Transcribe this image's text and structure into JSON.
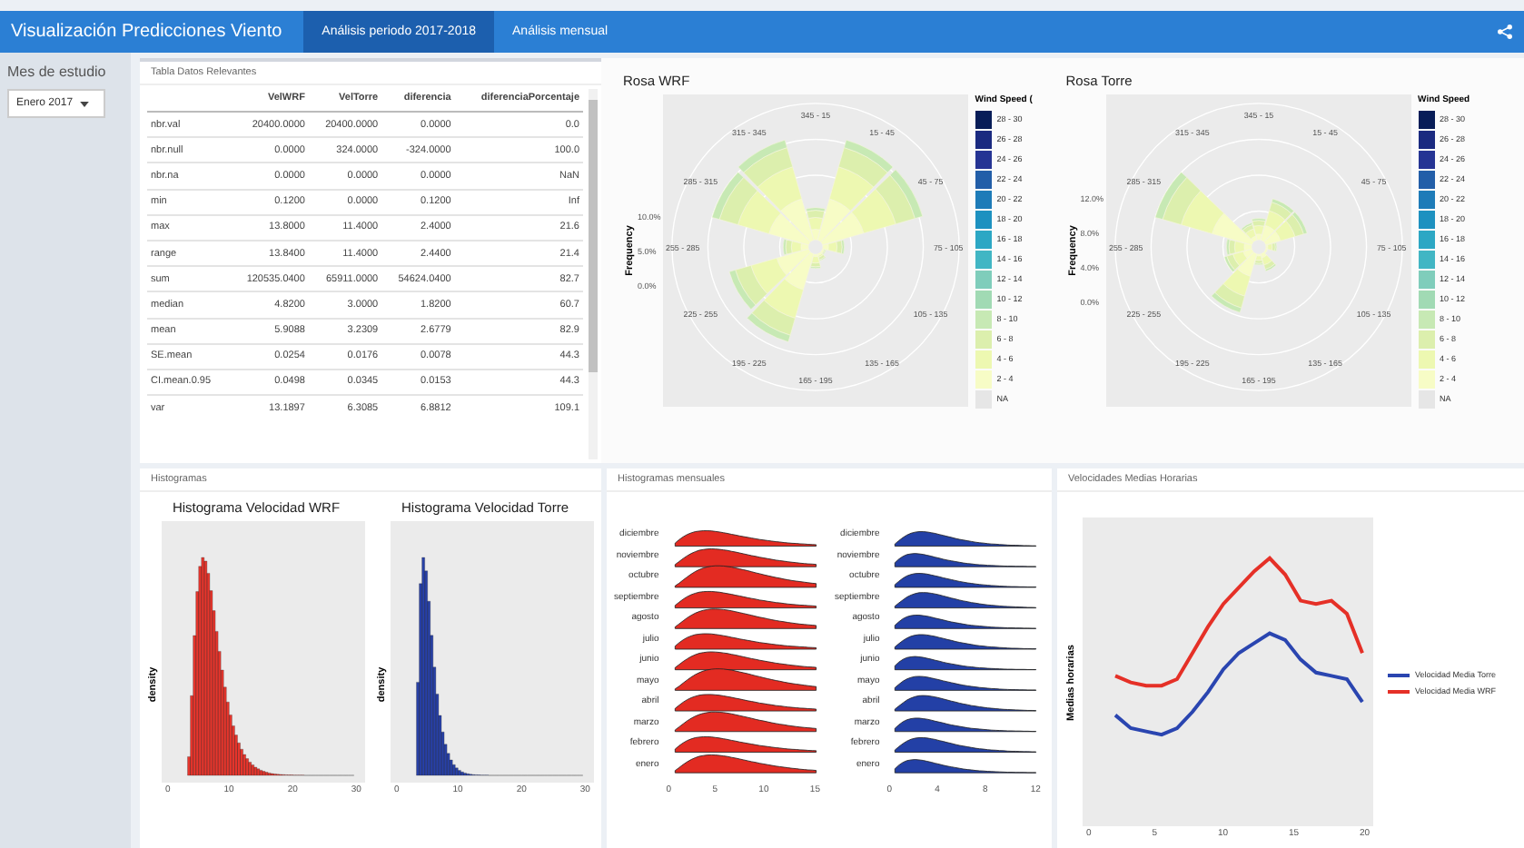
{
  "navbar": {
    "title": "Visualización Predicciones Viento",
    "tabs": [
      {
        "label": "Análisis periodo 2017-2018",
        "selected": true
      },
      {
        "label": "Análisis mensual",
        "selected": false
      }
    ]
  },
  "sidebar": {
    "label": "Mes de estudio",
    "dropdown": {
      "value": "Enero 2017"
    }
  },
  "table_panel": {
    "title": "Tabla Datos Relevantes",
    "columns": [
      "VelWRF",
      "VelTorre",
      "diferencia",
      "diferenciaPorcentaje"
    ],
    "rows": [
      {
        "name": "nbr.val",
        "cells": [
          "20400.0000",
          "20400.0000",
          "0.0000",
          "0.0"
        ]
      },
      {
        "name": "nbr.null",
        "cells": [
          "0.0000",
          "324.0000",
          "-324.0000",
          "100.0"
        ]
      },
      {
        "name": "nbr.na",
        "cells": [
          "0.0000",
          "0.0000",
          "0.0000",
          "NaN"
        ]
      },
      {
        "name": "min",
        "cells": [
          "0.1200",
          "0.0000",
          "0.1200",
          "Inf"
        ]
      },
      {
        "name": "max",
        "cells": [
          "13.8000",
          "11.4000",
          "2.4000",
          "21.6"
        ]
      },
      {
        "name": "range",
        "cells": [
          "13.8400",
          "11.4000",
          "2.4400",
          "21.4"
        ]
      },
      {
        "name": "sum",
        "cells": [
          "120535.0400",
          "65911.0000",
          "54624.0400",
          "82.7"
        ]
      },
      {
        "name": "median",
        "cells": [
          "4.8200",
          "3.0000",
          "1.8200",
          "60.7"
        ]
      },
      {
        "name": "mean",
        "cells": [
          "5.9088",
          "3.2309",
          "2.6779",
          "82.9"
        ]
      },
      {
        "name": "SE.mean",
        "cells": [
          "0.0254",
          "0.0176",
          "0.0078",
          "44.3"
        ]
      },
      {
        "name": "CI.mean.0.95",
        "cells": [
          "0.0498",
          "0.0345",
          "0.0153",
          "44.3"
        ]
      },
      {
        "name": "var",
        "cells": [
          "13.1897",
          "6.3085",
          "6.8812",
          "109.1"
        ]
      }
    ]
  },
  "roses": [
    {
      "title": "Rosa WRF",
      "legend_title": "Wind Speed (",
      "y_label": "Frequency",
      "y_ticks": [
        "10.0%",
        "5.0%",
        "0.0%"
      ],
      "directions": [
        "345 - 15",
        "15 - 45",
        "45 - 75",
        "75 - 105",
        "105 - 135",
        "135 - 165",
        "165 - 195",
        "195 - 225",
        "225 - 255",
        "255 - 285",
        "285 - 315",
        "315 - 345"
      ],
      "legend": [
        {
          "label": "28 - 30",
          "color": "#081d58"
        },
        {
          "label": "26 - 28",
          "color": "#1a2a80"
        },
        {
          "label": "24 - 26",
          "color": "#253494"
        },
        {
          "label": "22 - 24",
          "color": "#225ea8"
        },
        {
          "label": "20 - 22",
          "color": "#1d7bb8"
        },
        {
          "label": "18 - 20",
          "color": "#1d91c0"
        },
        {
          "label": "16 - 18",
          "color": "#2ca7c4"
        },
        {
          "label": "14 - 16",
          "color": "#41b6c4"
        },
        {
          "label": "12 - 14",
          "color": "#7fcdbb"
        },
        {
          "label": "10 - 12",
          "color": "#a1dab4"
        },
        {
          "label": "8 - 10",
          "color": "#c7e9b4"
        },
        {
          "label": "6 - 8",
          "color": "#dcefad"
        },
        {
          "label": "4 - 6",
          "color": "#edf8b1"
        },
        {
          "label": "2 - 4",
          "color": "#f7fcc6"
        },
        {
          "label": "NA",
          "color": "#e6e6e6"
        }
      ]
    },
    {
      "title": "Rosa Torre",
      "legend_title": "Wind Speed",
      "y_label": "Frequency",
      "y_ticks": [
        "12.0%",
        "8.0%",
        "4.0%",
        "0.0%"
      ],
      "directions": [
        "345 - 15",
        "15 - 45",
        "45 - 75",
        "75 - 105",
        "105 - 135",
        "135 - 165",
        "165 - 195",
        "195 - 225",
        "225 - 255",
        "255 - 285",
        "285 - 315",
        "315 - 345"
      ],
      "legend": [
        {
          "label": "28 - 30",
          "color": "#081d58"
        },
        {
          "label": "26 - 28",
          "color": "#1a2a80"
        },
        {
          "label": "24 - 26",
          "color": "#253494"
        },
        {
          "label": "22 - 24",
          "color": "#225ea8"
        },
        {
          "label": "20 - 22",
          "color": "#1d7bb8"
        },
        {
          "label": "18 - 20",
          "color": "#1d91c0"
        },
        {
          "label": "16 - 18",
          "color": "#2ca7c4"
        },
        {
          "label": "14 - 16",
          "color": "#41b6c4"
        },
        {
          "label": "12 - 14",
          "color": "#7fcdbb"
        },
        {
          "label": "10 - 12",
          "color": "#a1dab4"
        },
        {
          "label": "8 - 10",
          "color": "#c7e9b4"
        },
        {
          "label": "6 - 8",
          "color": "#dcefad"
        },
        {
          "label": "4 - 6",
          "color": "#edf8b1"
        },
        {
          "label": "2 - 4",
          "color": "#f7fcc6"
        },
        {
          "label": "NA",
          "color": "#e6e6e6"
        }
      ]
    }
  ],
  "histograms": {
    "title": "Histogramas",
    "charts": [
      {
        "title": "Histograma Velocidad WRF",
        "ylabel": "density",
        "color": "#e8352c",
        "xticks": [
          "0",
          "10",
          "20",
          "30"
        ]
      },
      {
        "title": "Histograma Velocidad Torre",
        "ylabel": "density",
        "color": "#2740a8",
        "xticks": [
          "0",
          "10",
          "20",
          "30"
        ]
      }
    ]
  },
  "ridges": {
    "title": "Histogramas mensuales",
    "charts": [
      {
        "color": "#e32b22",
        "months": [
          "diciembre",
          "noviembre",
          "octubre",
          "septiembre",
          "agosto",
          "julio",
          "junio",
          "mayo",
          "abril",
          "marzo",
          "febrero",
          "enero"
        ],
        "xticks": [
          "0",
          "5",
          "10",
          "15"
        ]
      },
      {
        "color": "#2340a6",
        "months": [
          "diciembre",
          "noviembre",
          "octubre",
          "septiembre",
          "agosto",
          "julio",
          "junio",
          "mayo",
          "abril",
          "marzo",
          "febrero",
          "enero"
        ],
        "xticks": [
          "0",
          "4",
          "8",
          "12"
        ]
      }
    ]
  },
  "hourly": {
    "title": "Velocidades Medias Horarias",
    "ylabel": "Medias horarias",
    "xticks": [
      "0",
      "5",
      "10",
      "15",
      "20"
    ],
    "series": [
      {
        "name": "Velocidad Media Torre",
        "color": "#2a45b0"
      },
      {
        "name": "Velocidad Media WRF",
        "color": "#e53027"
      }
    ]
  }
}
